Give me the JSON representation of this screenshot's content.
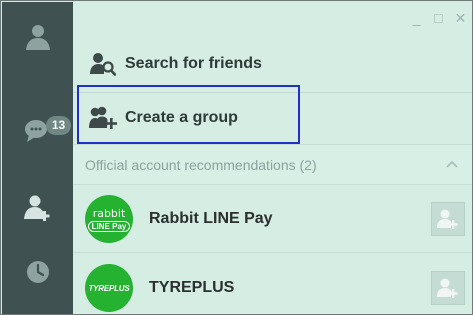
{
  "window": {
    "controls": [
      {
        "name": "minimize",
        "glyph": "_"
      },
      {
        "name": "maximize",
        "glyph": "□"
      },
      {
        "name": "close",
        "glyph": "✕"
      }
    ]
  },
  "sidebar": {
    "items": [
      {
        "icon": "person-icon",
        "label": ""
      },
      {
        "icon": "chat-bubbles-icon",
        "badge": "13"
      },
      {
        "icon": "add-friend-icon"
      },
      {
        "icon": "clock-icon"
      }
    ]
  },
  "actions": {
    "search_friends": "Search for friends",
    "create_group": "Create a group"
  },
  "section": {
    "title": "Official account recommendations (2)"
  },
  "accounts": [
    {
      "name": "Rabbit LINE Pay",
      "logo_top": "rabbit",
      "logo_pill": "LINE Pay"
    },
    {
      "name": "TYREPLUS",
      "logo_text": "TYREPLUS"
    }
  ],
  "colors": {
    "rail": "#3f5151",
    "panel": "#d5ede3",
    "highlight": "#2031c9",
    "logo_green": "#24b230"
  }
}
